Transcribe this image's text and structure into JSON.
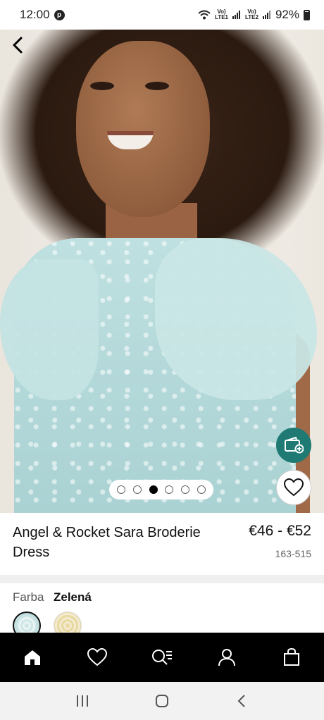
{
  "status_bar": {
    "time": "12:00",
    "pin_glyph": "p",
    "net1": "Vo)\nLTE1",
    "net2": "Vo)\nLTE2",
    "battery": "92%"
  },
  "gallery": {
    "image_count": 6,
    "active_index": 2
  },
  "product": {
    "name": "Angel & Rocket Sara Broderie Dress",
    "price": "€46 - €52",
    "sku": "163-515"
  },
  "color": {
    "label": "Farba",
    "value": "Zelená",
    "swatches": [
      {
        "name": "mint",
        "selected": true
      },
      {
        "name": "gold",
        "selected": false
      }
    ]
  },
  "bottom_nav": {
    "items": [
      "home-icon",
      "heart-icon",
      "search-list-icon",
      "account-icon",
      "bag-icon"
    ],
    "active": "home-icon"
  },
  "icons": {
    "back": "chevron-left-icon",
    "wallet": "wallet-plus-icon",
    "favorite": "heart-icon"
  },
  "colors": {
    "accent": "#1f7a74",
    "nav_bg": "#000000"
  }
}
